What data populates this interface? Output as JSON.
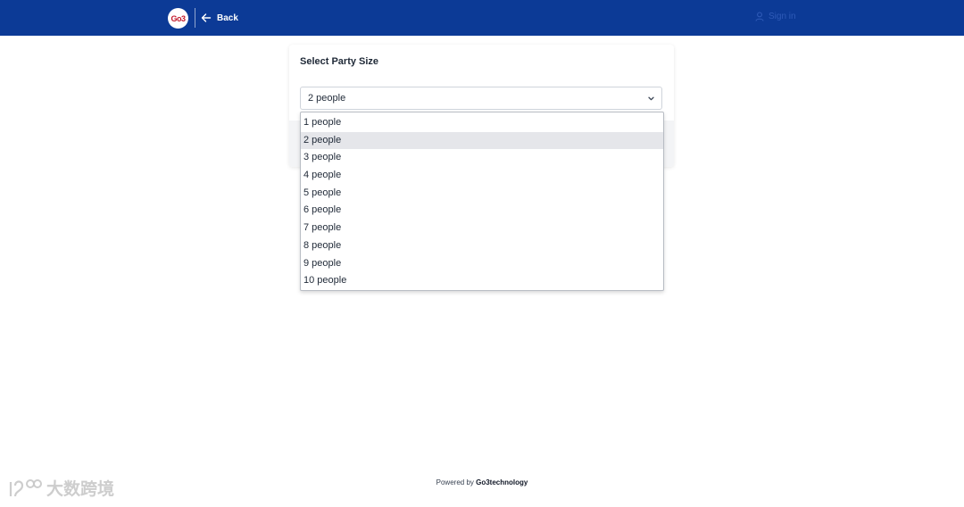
{
  "header": {
    "logo_text": "Go3",
    "back_label": "Back",
    "signin_label": "Sign in",
    "background_color": "#0c3a96"
  },
  "card": {
    "title": "Select Party Size",
    "select_value": "2 people"
  },
  "dropdown": {
    "options": [
      "1 people",
      "2 people",
      "3 people",
      "4 people",
      "5 people",
      "6 people",
      "7 people",
      "8 people",
      "9 people",
      "10 people"
    ],
    "selected": "2 people"
  },
  "footer": {
    "prefix": "Powered by ",
    "brand": "Go3technology"
  },
  "watermark": {
    "text": "大数跨境"
  },
  "icons": {
    "back": "arrow-left-icon",
    "signin": "user-icon",
    "select": "chevron-down-icon"
  }
}
